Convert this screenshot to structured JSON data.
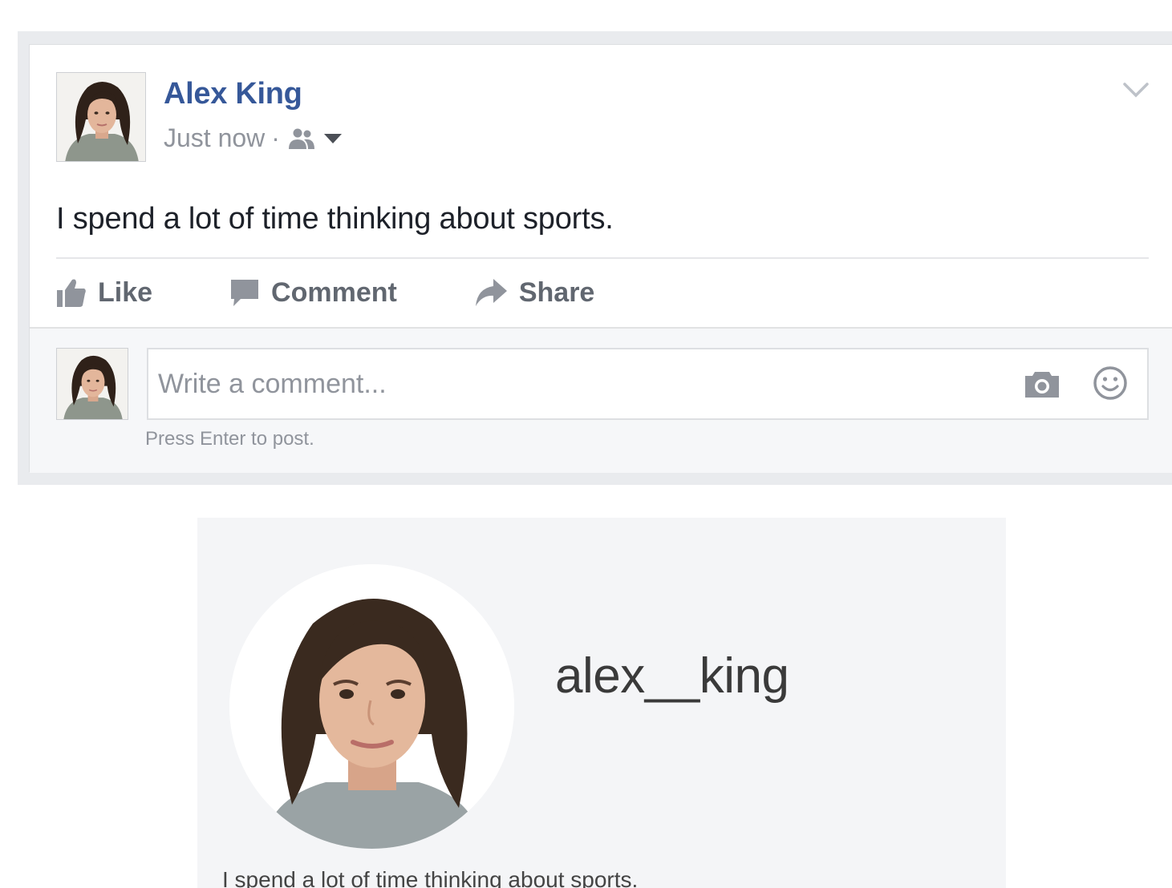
{
  "post": {
    "author": "Alex King",
    "timestamp": "Just now",
    "separator": "·",
    "audience_icon": "friends-icon",
    "text": "I spend a lot of time thinking about sports.",
    "actions": {
      "like": "Like",
      "comment": "Comment",
      "share": "Share"
    },
    "comment_box": {
      "placeholder": "Write a comment...",
      "hint": "Press Enter to post."
    }
  },
  "profile": {
    "username": "alex__king",
    "bio": "I spend a lot of time thinking about sports."
  },
  "colors": {
    "author_blue": "#365899",
    "meta_gray": "#90949c",
    "action_gray": "#616770",
    "text_dark": "#1d2129",
    "feed_background": "#e9ebee",
    "profile_background": "#f4f5f7"
  }
}
